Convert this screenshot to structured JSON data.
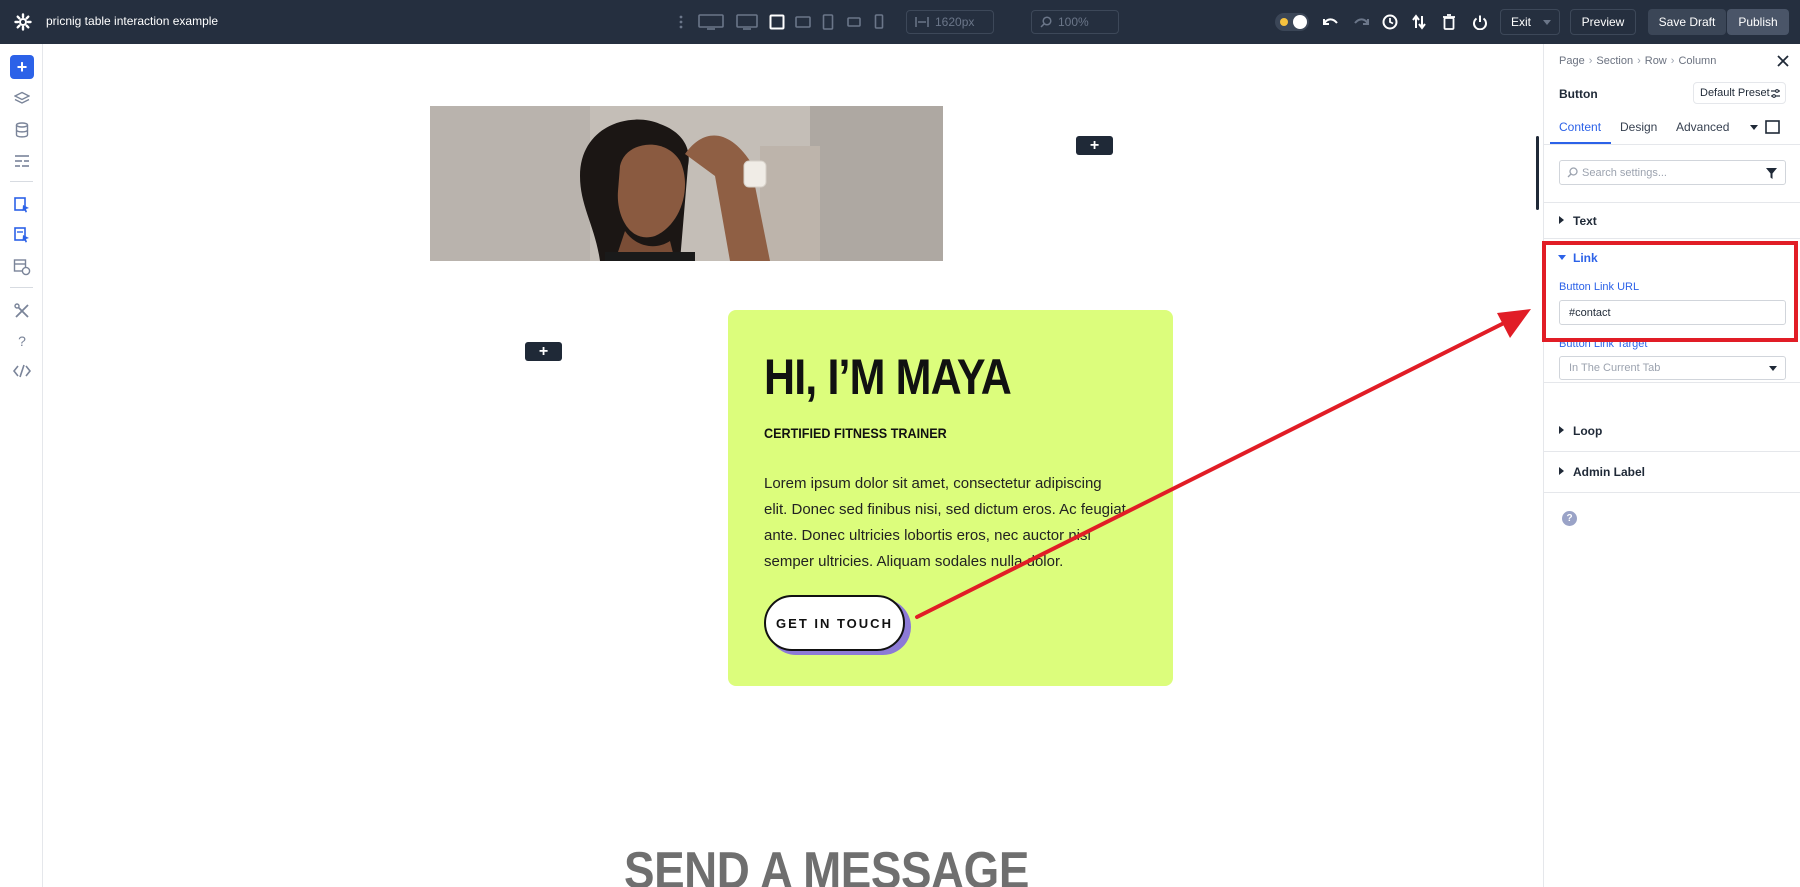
{
  "topbar": {
    "title": "pricnig table interaction example",
    "width_value": "1620px",
    "zoom_value": "100%",
    "exit_label": "Exit",
    "preview_label": "Preview",
    "save_draft_label": "Save Draft",
    "publish_label": "Publish",
    "colors": {
      "bg": "#252f3f",
      "save_bg": "#3b4657",
      "publish_bg": "#4a5568"
    }
  },
  "leftrail": {
    "items": [
      "add-icon",
      "layers-icon",
      "database-icon",
      "layout-icon",
      "pages-icon",
      "history-icon",
      "portability-icon",
      "tools-icon",
      "help-icon",
      "code-icon"
    ]
  },
  "canvas": {
    "hero_image_alt": "",
    "card": {
      "heading": "HI, I’M MAYA",
      "subheading": "CERTIFIED FITNESS TRAINER",
      "body": "Lorem ipsum dolor sit amet, consectetur adipiscing elit. Donec sed finibus nisi, sed dictum eros. Ac feugiat ante. Donec ultricies lobortis eros, nec auctor nisl semper ultricies. Aliquam sodales nulla dolor.",
      "button_label": "GET IN TOUCH",
      "bg_color": "#dcfd7c"
    },
    "section_title": "SEND A MESSAGE"
  },
  "panel": {
    "breadcrumb": [
      "Page",
      "Section",
      "Row",
      "Column"
    ],
    "module_name": "Button",
    "preset_label": "Default Preset",
    "tabs": [
      {
        "label": "Content",
        "active": true
      },
      {
        "label": "Design",
        "active": false
      },
      {
        "label": "Advanced",
        "active": false
      }
    ],
    "search_placeholder": "Search settings...",
    "sections": {
      "text": "Text",
      "link": "Link",
      "loop": "Loop",
      "admin_label": "Admin Label"
    },
    "link_fields": {
      "url_label": "Button Link URL",
      "url_value": "#contact",
      "target_label": "Button Link Target",
      "target_value": "In The Current Tab"
    },
    "accent_color": "#2c62e8"
  },
  "annotation": {
    "color": "#e11d26"
  }
}
